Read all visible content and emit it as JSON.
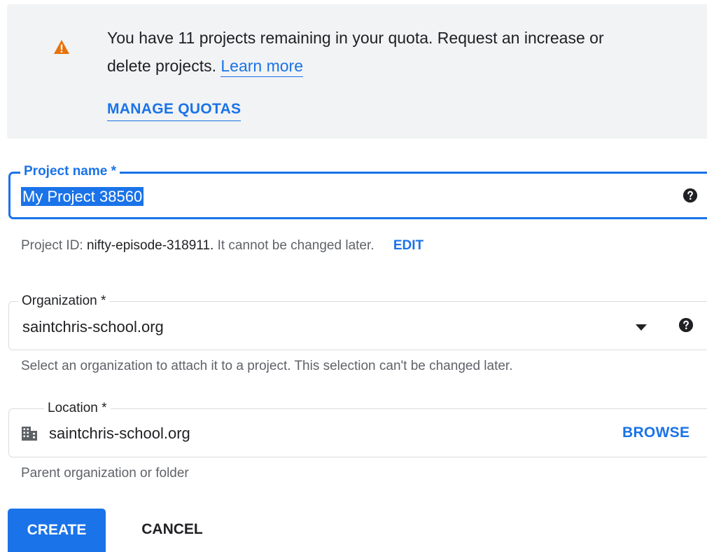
{
  "quota_banner": {
    "message_line1": "You have 11 projects remaining in your quota. Request an increase or",
    "message_line2": "delete projects.",
    "learn_more": "Learn more",
    "manage_quotas": "MANAGE QUOTAS",
    "icon": "warning-icon",
    "icon_color": "#e8710a"
  },
  "project_name": {
    "label": "Project name *",
    "value": "My Project 38560",
    "help_icon": "help-icon"
  },
  "project_id": {
    "prefix": "Project ID:",
    "id": "nifty-episode-318911.",
    "suffix": "It cannot be changed later.",
    "edit": "EDIT"
  },
  "organization": {
    "label": "Organization *",
    "value": "saintchris-school.org",
    "hint": "Select an organization to attach it to a project. This selection can't be changed later.",
    "help_icon": "help-icon"
  },
  "location": {
    "label": "Location *",
    "value": "saintchris-school.org",
    "browse": "BROWSE",
    "hint": "Parent organization or folder",
    "icon": "organization-building-icon"
  },
  "actions": {
    "create": "CREATE",
    "cancel": "CANCEL"
  },
  "colors": {
    "accent": "#1a73e8",
    "banner_bg": "#f1f3f4",
    "warning": "#e8710a"
  }
}
